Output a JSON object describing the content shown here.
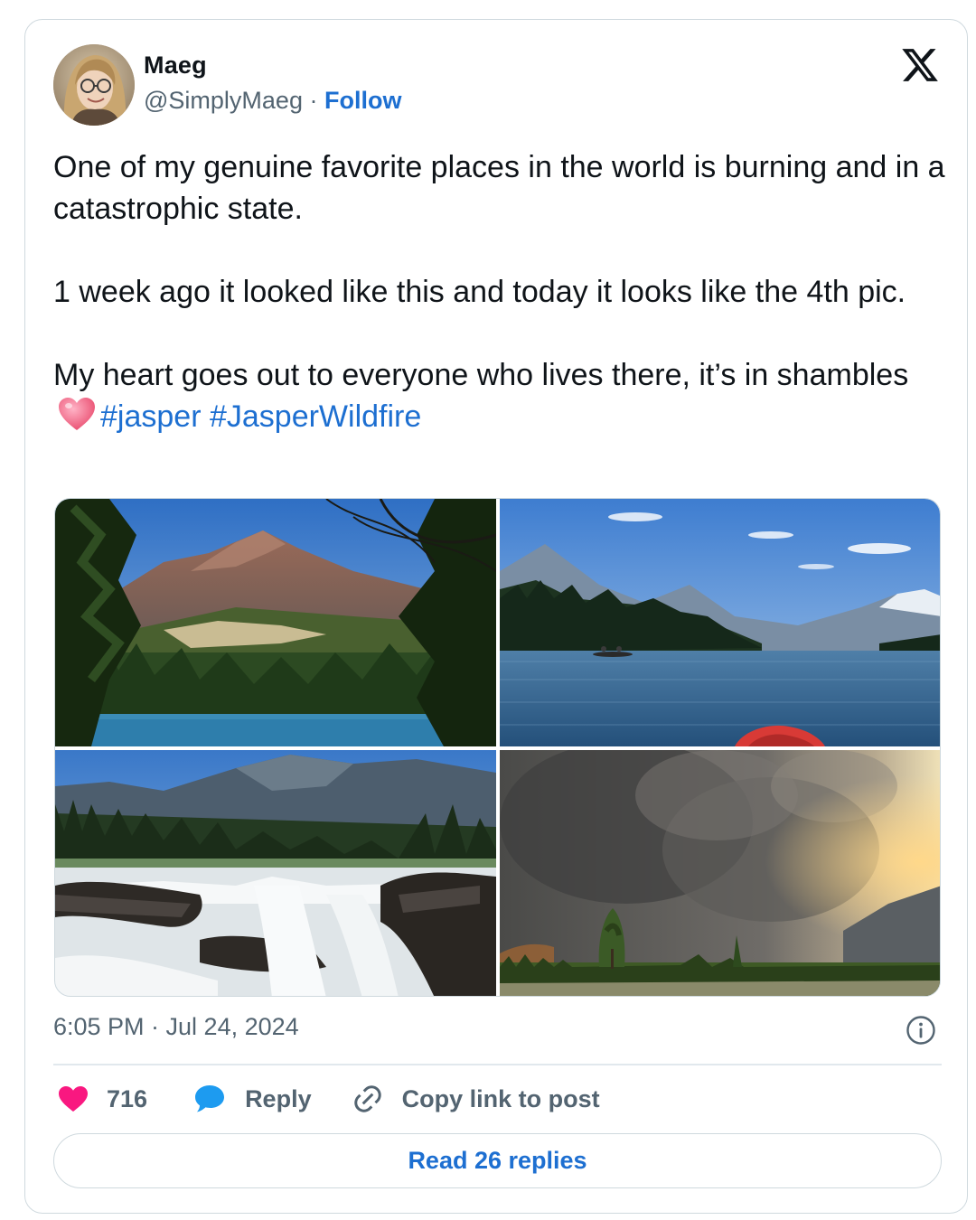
{
  "author": {
    "display_name": "Maeg",
    "handle": "@SimplyMaeg",
    "separator": " · ",
    "follow_label": "Follow"
  },
  "tweet": {
    "paragraph_1": "One of my genuine favorite places in the world is burning and in a catastrophic state.",
    "paragraph_2": "1 week ago it looked like this and today it looks like the 4th pic.",
    "paragraph_3": "My heart goes out to everyone who lives there, it’s in shambles",
    "hashtag_1": "#jasper",
    "hashtag_2": "#JasperWildfire",
    "emoji": "heart-emoji"
  },
  "media": {
    "count": 4,
    "photos": [
      {
        "name": "mountain-forest-lake-photo"
      },
      {
        "name": "lake-kayak-photo"
      },
      {
        "name": "waterfall-photo"
      },
      {
        "name": "wildfire-smoke-photo"
      }
    ]
  },
  "timestamp": "6:05 PM · Jul 24, 2024",
  "actions": {
    "like_count": "716",
    "reply_label": "Reply",
    "copy_link_label": "Copy link to post"
  },
  "read_replies_label": "Read 26 replies",
  "colors": {
    "link_blue": "#1d6fd1",
    "like_pink": "#f91880",
    "reply_blue": "#1d9bf0",
    "muted_gray": "#536471",
    "border": "#cfd9de"
  },
  "icons": [
    "x-logo-icon",
    "info-icon",
    "heart-icon",
    "reply-bubble-icon",
    "link-icon"
  ]
}
